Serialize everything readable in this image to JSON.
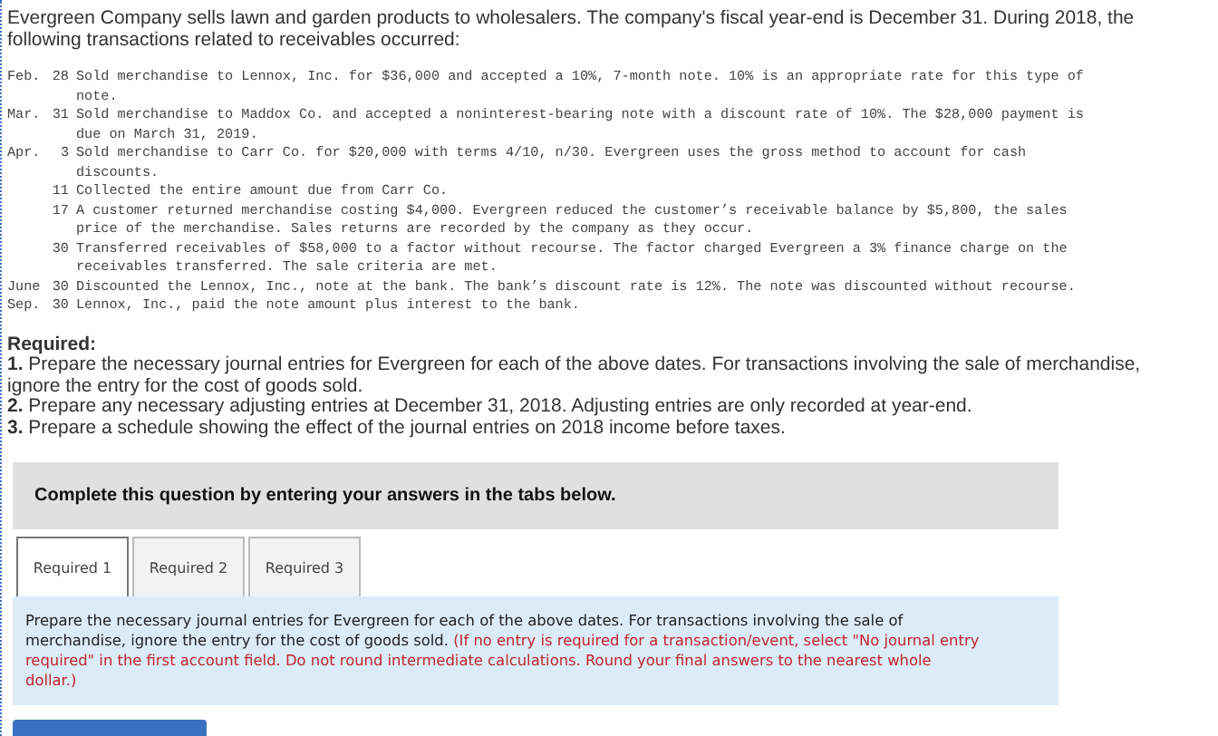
{
  "intro": "Evergreen Company sells lawn and garden products to wholesalers. The company's fiscal year-end is December 31. During 2018, the following transactions related to receivables occurred:",
  "transactions": [
    {
      "month": "Feb.",
      "day": "28",
      "text": "Sold merchandise to Lennox, Inc. for $36,000 and accepted a 10%, 7-month note. 10% is an appropriate rate for this type of note."
    },
    {
      "month": "Mar.",
      "day": "31",
      "text": "Sold merchandise to Maddox Co. and accepted a noninterest-bearing note with a discount rate of 10%. The $28,000 payment is due on March 31, 2019."
    },
    {
      "month": "Apr.",
      "day": "3",
      "text": "Sold merchandise to Carr Co. for $20,000 with terms 4/10, n/30. Evergreen uses the gross method to account for cash discounts."
    },
    {
      "day": "11",
      "text": "Collected the entire amount due from Carr Co."
    },
    {
      "day": "17",
      "text": "A customer returned merchandise costing $4,000. Evergreen reduced the customer’s receivable balance by $5,800, the sales price of the merchandise. Sales returns are recorded by the company as they occur."
    },
    {
      "day": "30",
      "text": "Transferred receivables of $58,000 to a factor without recourse. The factor charged Evergreen a 3% finance charge on the receivables transferred. The sale criteria are met."
    },
    {
      "month": "June",
      "day": "30",
      "text": "Discounted the Lennox, Inc., note at the bank. The bank’s discount rate is 12%. The note was discounted without recourse."
    },
    {
      "month": "Sep.",
      "day": "30",
      "text": "Lennox, Inc., paid the note amount plus interest to the bank."
    }
  ],
  "required": {
    "title": "Required:",
    "items": [
      {
        "text": "**1.** Prepare the necessary journal entries for Evergreen for each of the above dates. For transactions involving the sale of merchandise, ignore the entry for the cost of goods sold."
      },
      {
        "text": "**2.** Prepare any necessary adjusting entries at December 31, 2018. Adjusting entries are only recorded at year-end."
      },
      {
        "text": "**3.** Prepare a schedule showing the effect of the journal entries on 2018 income before taxes."
      }
    ]
  },
  "instruction": "Complete this question by entering your answers in the tabs below.",
  "tabs": [
    {
      "label": "Required 1",
      "selected": true
    },
    {
      "label": "Required 2",
      "selected": false
    },
    {
      "label": "Required 3",
      "selected": false
    }
  ],
  "tab_content": {
    "text": "Prepare the necessary journal entries for Evergreen for each of the above dates. For transactions involving the sale of merchandise, ignore the entry for the cost of goods sold.",
    "note": "(If no entry is required for a transaction/event, select \"No journal entry required\" in the first account field. Do not round intermediate calculations. Round your final answers to the nearest whole dollar.)"
  }
}
